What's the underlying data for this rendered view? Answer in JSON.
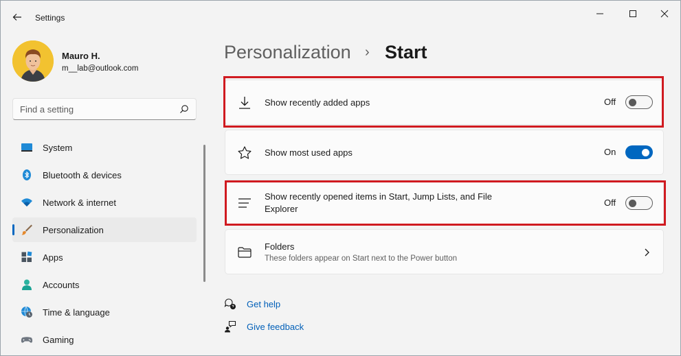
{
  "app": {
    "title": "Settings"
  },
  "user": {
    "name": "Mauro H.",
    "email": "m__lab@outlook.com"
  },
  "search": {
    "placeholder": "Find a setting"
  },
  "nav": [
    {
      "label": "System",
      "icon": "monitor-icon"
    },
    {
      "label": "Bluetooth & devices",
      "icon": "bluetooth-icon"
    },
    {
      "label": "Network & internet",
      "icon": "wifi-icon"
    },
    {
      "label": "Personalization",
      "icon": "brush-icon",
      "active": true
    },
    {
      "label": "Apps",
      "icon": "apps-icon"
    },
    {
      "label": "Accounts",
      "icon": "person-icon"
    },
    {
      "label": "Time & language",
      "icon": "globe-clock-icon"
    },
    {
      "label": "Gaming",
      "icon": "gamepad-icon"
    }
  ],
  "breadcrumb": {
    "parent": "Personalization",
    "separator": "›",
    "current": "Start"
  },
  "settings": {
    "recently_added": {
      "label": "Show recently added apps",
      "state": "Off"
    },
    "most_used": {
      "label": "Show most used apps",
      "state": "On"
    },
    "recently_opened": {
      "label_line1": "Show recently opened items in Start, Jump Lists, and File",
      "label_line2": "Explorer",
      "state": "Off"
    },
    "folders": {
      "label": "Folders",
      "description": "These folders appear on Start next to the Power button"
    }
  },
  "links": {
    "help": "Get help",
    "feedback": "Give feedback"
  },
  "colors": {
    "accent": "#0067c0",
    "highlight": "#d01a20",
    "link": "#005fb8"
  }
}
